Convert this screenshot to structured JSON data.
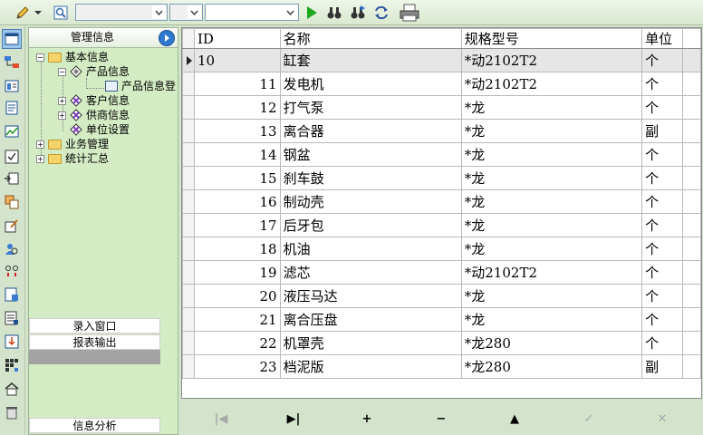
{
  "toolbar": {
    "combo1_value": "",
    "combo2_value": "",
    "combo3_value": "",
    "icons": [
      "pencil-icon",
      "find-icon",
      "play-icon",
      "binoculars-icon",
      "binoculars-next-icon",
      "refresh-icon",
      "print-icon"
    ]
  },
  "nav": {
    "title": "管理信息",
    "tree": {
      "basic": "基本信息",
      "product": "产品信息",
      "product_reg": "产品信息登",
      "customer": "客户信息",
      "supplier": "供商信息",
      "unit_settings": "单位设置",
      "business": "业务管理",
      "stats": "统计汇总"
    },
    "bottom": {
      "entry_window": "录入窗口",
      "report_output": "报表输出",
      "info_analysis": "信息分析"
    }
  },
  "grid": {
    "columns": [
      "ID",
      "名称",
      "规格型号",
      "单位"
    ],
    "rows": [
      {
        "id": "10",
        "name": "缸套",
        "spec": "*动2102T2",
        "unit": "个"
      },
      {
        "id": "11",
        "name": "发电机",
        "spec": "*动2102T2",
        "unit": "个"
      },
      {
        "id": "12",
        "name": "打气泵",
        "spec": "*龙",
        "unit": "个"
      },
      {
        "id": "13",
        "name": "离合器",
        "spec": "*龙",
        "unit": "副"
      },
      {
        "id": "14",
        "name": "钢盆",
        "spec": "*龙",
        "unit": "个"
      },
      {
        "id": "15",
        "name": "刹车鼓",
        "spec": "*龙",
        "unit": "个"
      },
      {
        "id": "16",
        "name": "制动壳",
        "spec": "*龙",
        "unit": "个"
      },
      {
        "id": "17",
        "name": "后牙包",
        "spec": "*龙",
        "unit": "个"
      },
      {
        "id": "18",
        "name": "机油",
        "spec": "*龙",
        "unit": "个"
      },
      {
        "id": "19",
        "name": "滤芯",
        "spec": "*动2102T2",
        "unit": "个"
      },
      {
        "id": "20",
        "name": "液压马达",
        "spec": "*龙",
        "unit": "个"
      },
      {
        "id": "21",
        "name": "离合压盘",
        "spec": "*龙",
        "unit": "个"
      },
      {
        "id": "22",
        "name": "机罩壳",
        "spec": "*龙280",
        "unit": "个"
      },
      {
        "id": "23",
        "name": "档泥版",
        "spec": "*龙280",
        "unit": "副"
      }
    ]
  },
  "navigator": {
    "first": "|◀",
    "last": "▶|",
    "insert": "+",
    "delete": "−",
    "edit": "▲",
    "post": "✓",
    "cancel": "✕"
  }
}
